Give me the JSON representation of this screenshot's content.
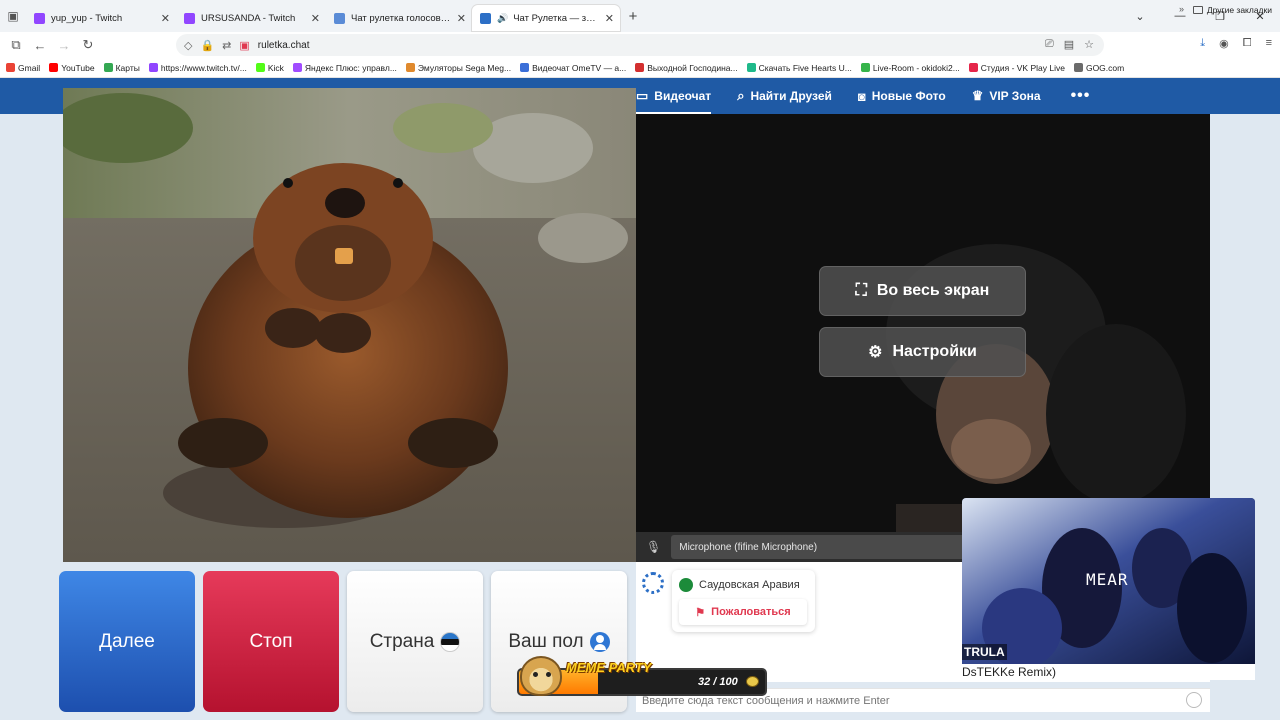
{
  "browser": {
    "tabs": [
      {
        "title": "yup_yup - Twitch",
        "color": "#9146ff",
        "active": false
      },
      {
        "title": "URSUSANDA - Twitch",
        "color": "#9146ff",
        "active": false
      },
      {
        "title": "Чат рулетка голосовая — Nekto",
        "color": "#5a8bd6",
        "active": false
      },
      {
        "title": "Чат Рулетка — знакомства",
        "color": "#2c6fc6",
        "active": true
      }
    ],
    "url": "ruletka.chat",
    "bookmarks": [
      {
        "label": "Gmail",
        "color": "#ea4335"
      },
      {
        "label": "YouTube",
        "color": "#ff0000"
      },
      {
        "label": "Карты",
        "color": "#34a853"
      },
      {
        "label": "https://www.twitch.tv/...",
        "color": "#9146ff"
      },
      {
        "label": "Kick",
        "color": "#53fc18"
      },
      {
        "label": "Яндекс Плюс: управл...",
        "color": "#a14cff"
      },
      {
        "label": "Эмуляторы Sega Meg...",
        "color": "#e08a2e"
      },
      {
        "label": "Видеочат OmeTV — a...",
        "color": "#3b6fd8"
      },
      {
        "label": "Выходной Господина...",
        "color": "#d32f2f"
      },
      {
        "label": "Скачать Five Hearts U...",
        "color": "#1fb98a"
      },
      {
        "label": "Live-Room - okidoki2...",
        "color": "#36b44a"
      },
      {
        "label": "Студия - VK Play Live",
        "color": "#e5264a"
      },
      {
        "label": "GOG.com",
        "color": "#6b6b6b"
      }
    ],
    "other_bookmarks": "Другие закладки"
  },
  "site": {
    "nav": [
      {
        "label": "Видеочат",
        "icon": "video-camera-icon",
        "active": true
      },
      {
        "label": "Найти Друзей",
        "icon": "search-icon",
        "active": false
      },
      {
        "label": "Новые Фото",
        "icon": "photo-camera-icon",
        "active": false
      },
      {
        "label": "VIP Зона",
        "icon": "crown-icon",
        "active": false
      }
    ],
    "overlay": {
      "fullscreen": "Во весь экран",
      "settings": "Настройки"
    },
    "microphone": "Microphone (fifine Microphone)",
    "buttons": {
      "next": "Далее",
      "stop": "Стоп",
      "country": "Страна",
      "gender": "Ваш пол"
    },
    "chat": {
      "country": "Саудовская Аравия",
      "report": "Пожаловаться",
      "input_placeholder": "Введите сюда текст сообщения и нажмите Enter"
    }
  },
  "stream_overlay": {
    "clip_tag": "TRULA",
    "clip_word": "MEAR",
    "clip_caption": "DsTEKKe Remix)",
    "meme_title": "MEME PARTY",
    "meme_progress": "32 / 100",
    "meme_fraction": 0.32
  }
}
